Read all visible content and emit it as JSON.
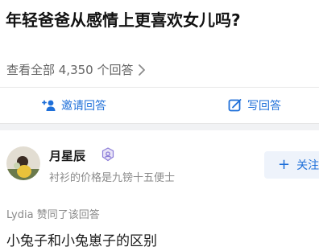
{
  "question": {
    "title": "年轻爸爸从感情上更喜欢女儿吗?"
  },
  "answers_link": {
    "label": "查看全部 4,350 个回答"
  },
  "actions": {
    "invite_label": "邀请回答",
    "write_label": "写回答"
  },
  "author": {
    "name": "月星辰",
    "bio": "衬衫的价格是九镑十五便士",
    "follow_label": "关注"
  },
  "activity": {
    "text": "Lydia 赞同了该回答"
  },
  "answer": {
    "excerpt": "小兔子和小兔崽子的区别"
  },
  "colors": {
    "accent": "#1e6fd9",
    "muted": "#8a8a8a",
    "band": "#f1f2f4"
  },
  "icons": {
    "invite": "add-person-icon",
    "write": "edit-icon",
    "chevron": "chevron-right-icon",
    "badge": "verified-badge-icon"
  }
}
